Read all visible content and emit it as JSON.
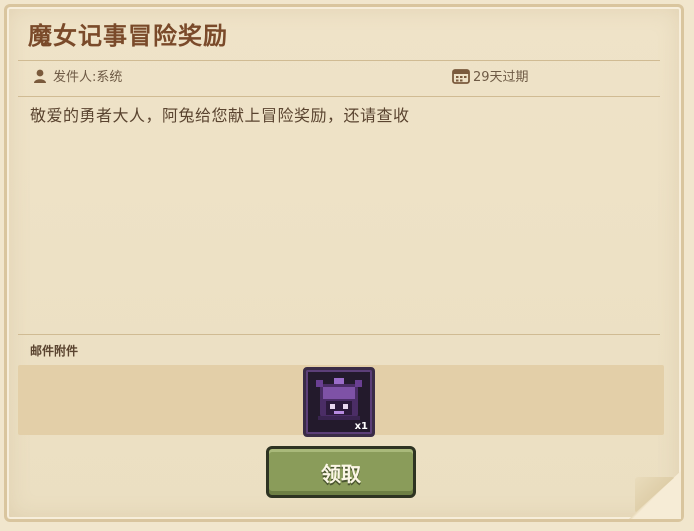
{
  "mail": {
    "title": "魔女记事冒险奖励",
    "sender": "发件人:系统",
    "expiry": "29天过期",
    "message": "敬爱的勇者大人，阿兔给您献上冒险奖励，还请查收",
    "attachments_label": "邮件附件",
    "attachments": [
      {
        "icon": "purple-monster-chest-icon",
        "count": "x1"
      }
    ],
    "claim_label": "领取"
  },
  "colors": {
    "title": "#7a4a2a",
    "paper": "#efe3c8",
    "attach_strip": "#e3cfa8",
    "button": "#8a9c5a",
    "item_slot": "#231a2c"
  }
}
